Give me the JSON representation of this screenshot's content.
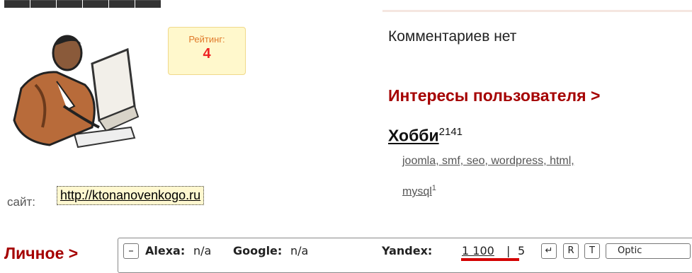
{
  "profile": {
    "rating_label": "Рейтинг:",
    "rating_value": "4",
    "site_label": "сайт:",
    "site_url": "http://ktonanovenkogo.ru"
  },
  "comments": {
    "empty_text": "Комментариев нет"
  },
  "interests": {
    "heading": "Интересы пользователя >",
    "hobby_title": "Хобби",
    "hobby_count": "2141",
    "tags_line1": "joomla, smf, seo, wordpress, html,",
    "tag_mysql": "mysql",
    "tag_mysql_count": "1"
  },
  "personal": {
    "heading": "Личное >"
  },
  "seo_toolbar": {
    "minimize": "–",
    "alexa_label": "Alexa:",
    "alexa_value": "n/a",
    "google_label": "Google:",
    "google_value": "n/a",
    "yandex_label": "Yandex:",
    "yandex_value": "1 100",
    "separator": "|",
    "yandex_extra": "5",
    "btn_enter": "↵",
    "btn_r": "R",
    "btn_t": "T",
    "btn_options": "Optic"
  },
  "colors": {
    "heading_red": "#a50000",
    "rating_bg": "#fff8cc",
    "rating_value": "#e22",
    "link_bg": "#fff8d0"
  }
}
